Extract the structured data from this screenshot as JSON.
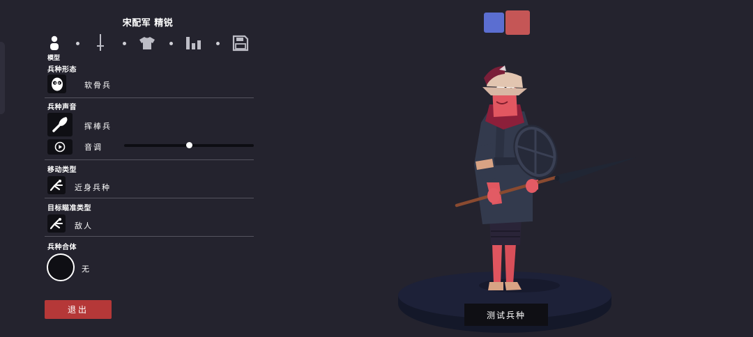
{
  "unit": {
    "name": "宋配军 精锐"
  },
  "tabs": {
    "items": [
      {
        "icon": "person-icon",
        "label": "模型"
      },
      {
        "icon": "sword-icon",
        "label": ""
      },
      {
        "icon": "shirt-icon",
        "label": ""
      },
      {
        "icon": "stats-icon",
        "label": ""
      },
      {
        "icon": "save-icon",
        "label": ""
      }
    ]
  },
  "sections": {
    "body_type": {
      "title": "兵种形态",
      "icon": "ragdoll-face-icon",
      "value": "软骨兵"
    },
    "voice": {
      "title": "兵种声音",
      "icon": "club-icon",
      "value": "挥棒兵",
      "pitch_label": "音调",
      "pitch_icon": "play-icon",
      "pitch_level": 0.5
    },
    "movement": {
      "title": "移动类型",
      "icon": "melee-move-icon",
      "value": "近身兵种"
    },
    "targeting": {
      "title": "目标瞄准类型",
      "icon": "target-enemy-icon",
      "value": "敌人"
    },
    "fusion": {
      "title": "兵种合体",
      "value": "无"
    }
  },
  "exit": {
    "label": "退出"
  },
  "teams": [
    {
      "icon": "team-blue",
      "color": "#5b6ed1"
    },
    {
      "icon": "team-red",
      "color": "#c55656",
      "selected": true
    }
  ],
  "test": {
    "label": "测试兵种"
  },
  "colors": {
    "background": "#24232e",
    "exit": "#b53838",
    "platform": "#1d2138"
  }
}
